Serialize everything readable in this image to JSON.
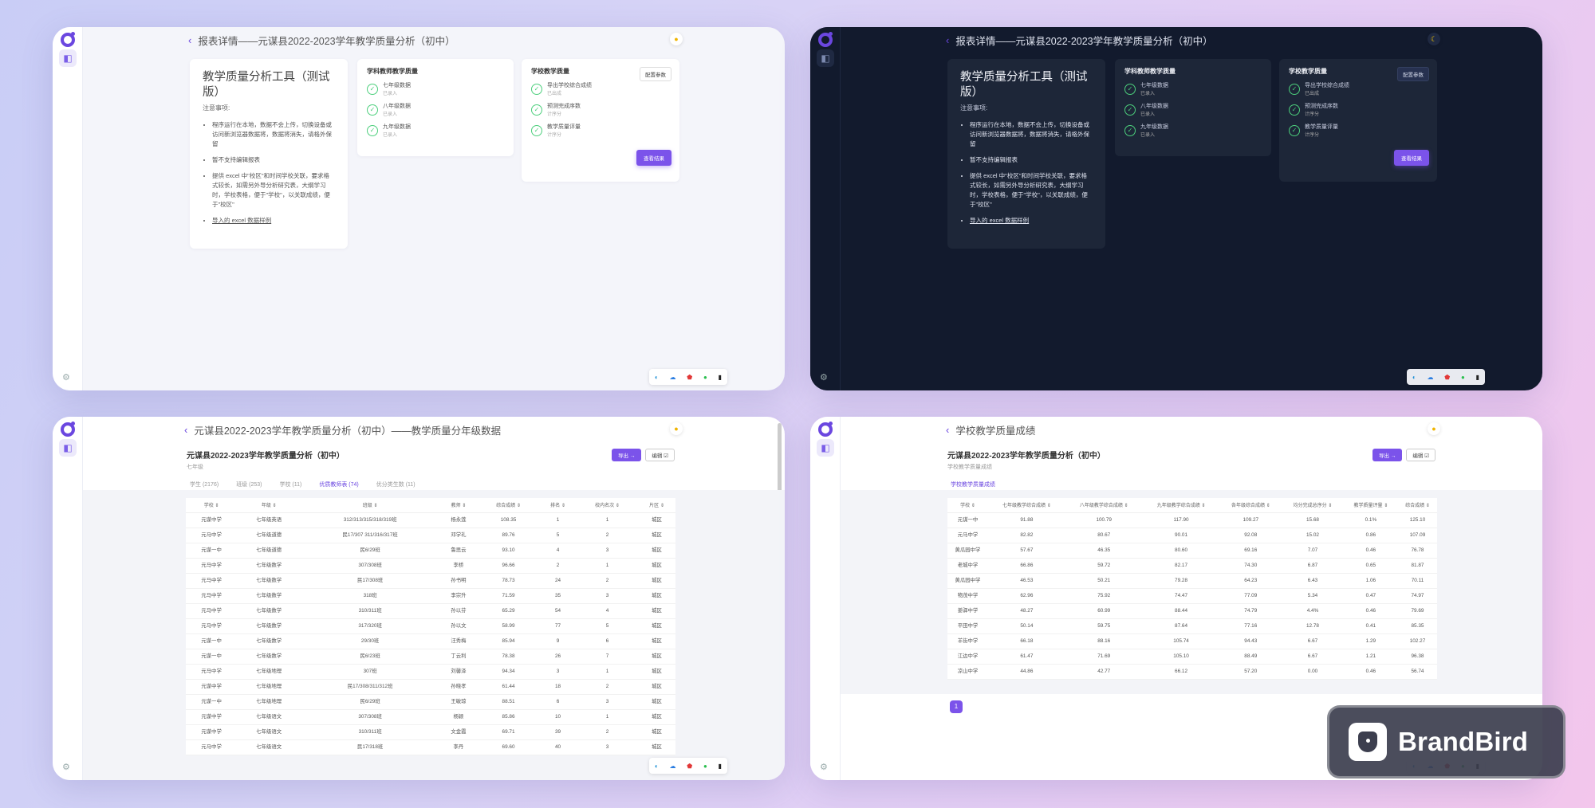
{
  "panel1": {
    "title": "报表详情——元谋县2022-2023学年教学质量分析（初中）",
    "intro": {
      "heading": "教学质量分析工具（测试版）",
      "notice": "注意事项:",
      "items": [
        "程序运行在本地，数据不会上传，切换设备或访问新浏览器数据将，数据将消失，请格外保留",
        "暂不支持编辑报表",
        "提供 excel 中\"校区\"和时间学校关联，要求格式较长，如需另外导分析研究表，大纲学习 时，学校表格，便于\"学校\"，以关联成绩，便于\"校区\"",
        "导入的 excel 数据样例"
      ]
    },
    "mid": {
      "title": "学科教师教学质量",
      "steps": [
        {
          "label": "七年级数据",
          "sub": "已录入"
        },
        {
          "label": "八年级数据",
          "sub": "已录入"
        },
        {
          "label": "九年级数据",
          "sub": "已录入"
        }
      ]
    },
    "right": {
      "title": "学校教学质量",
      "config": "配置参数",
      "steps": [
        {
          "label": "导出学校综合成绩",
          "sub": "已出成"
        },
        {
          "label": "预测完成序数",
          "sub": "计序分"
        },
        {
          "label": "教学质量评量",
          "sub": "计序分"
        }
      ],
      "go": "查看结果"
    }
  },
  "panel2": {
    "title": "报表详情——元谋县2022-2023学年教学质量分析（初中）"
  },
  "panel3": {
    "title": "元谋县2022-2023学年教学质量分析（初中）——教学质量分年级数据",
    "report": "元谋县2022-2023学年教学质量分析（初中）",
    "sub": "七年级",
    "export": "导出 →",
    "edit": "编辑 ☑",
    "tabs": [
      "学生 (2176)",
      "班级 (253)",
      "学校 (11)",
      "优质教师表 (74)",
      "优分类生数 (11)"
    ],
    "headers": [
      "学校 ⇕",
      "年级 ⇕",
      "班级 ⇕",
      "教师 ⇕",
      "综合成绩 ⇕",
      "排名 ⇕",
      "校内名次 ⇕",
      "片区 ⇕"
    ],
    "rows": [
      [
        "元谋中学",
        "七年级英语",
        "312/313/315/318/319班",
        "杨永莲",
        "108.35",
        "1",
        "1",
        "城区"
      ],
      [
        "元马中学",
        "七年级道德",
        "民17/307 311/316/317班",
        "邓学礼",
        "89.76",
        "5",
        "2",
        "城区"
      ],
      [
        "元谋一中",
        "七年级道德",
        "民6/29班",
        "鲁思云",
        "93.10",
        "4",
        "3",
        "城区"
      ],
      [
        "元马中学",
        "七年级数学",
        "307/308班",
        "李桥",
        "96.66",
        "2",
        "1",
        "城区"
      ],
      [
        "元马中学",
        "七年级数学",
        "民17/308班",
        "孙书明",
        "78.73",
        "24",
        "2",
        "城区"
      ],
      [
        "元马中学",
        "七年级数学",
        "318班",
        "李宗升",
        "71.59",
        "35",
        "3",
        "城区"
      ],
      [
        "元马中学",
        "七年级数学",
        "310/311班",
        "孙以芬",
        "65.29",
        "54",
        "4",
        "城区"
      ],
      [
        "元马中学",
        "七年级数学",
        "317/320班",
        "孙以文",
        "58.99",
        "77",
        "5",
        "城区"
      ],
      [
        "元谋一中",
        "七年级数学",
        "29/30班",
        "汪秀梅",
        "85.94",
        "9",
        "6",
        "城区"
      ],
      [
        "元谋一中",
        "七年级数学",
        "民6/23班",
        "丁云利",
        "78.38",
        "26",
        "7",
        "城区"
      ],
      [
        "元马中学",
        "七年级地理",
        "307班",
        "刘馨泽",
        "94.34",
        "3",
        "1",
        "城区"
      ],
      [
        "元谋中学",
        "七年级地理",
        "民17/308/311/312班",
        "孙晓孝",
        "61.44",
        "18",
        "2",
        "城区"
      ],
      [
        "元谋一中",
        "七年级地理",
        "民6/29班",
        "王敏琼",
        "88.51",
        "6",
        "3",
        "城区"
      ],
      [
        "元谋中学",
        "七年级语文",
        "307/308班",
        "杨颖",
        "85.86",
        "10",
        "1",
        "城区"
      ],
      [
        "元谋中学",
        "七年级语文",
        "310/311班",
        "文金霞",
        "69.71",
        "39",
        "2",
        "城区"
      ],
      [
        "元马中学",
        "七年级语文",
        "民17/318班",
        "李丹",
        "69.60",
        "40",
        "3",
        "城区"
      ]
    ]
  },
  "panel4": {
    "title": "学校教学质量成绩",
    "report": "元谋县2022-2023学年教学质量分析（初中）",
    "sub": "学校教学质量成绩",
    "export": "导出 →",
    "edit": "编辑 ☑",
    "tab": "学校教学质量成绩",
    "headers": [
      "学校 ⇕",
      "七年级教学综合成绩 ⇕",
      "八年级教学综合成绩 ⇕",
      "九年级教学综合成绩 ⇕",
      "各年级综合成绩 ⇕",
      "均分完成总序分 ⇕",
      "教学质量评量 ⇕",
      "综合成绩 ⇕"
    ],
    "rows": [
      [
        "元谋一中",
        "91.88",
        "100.79",
        "117.90",
        "109.27",
        "15.68",
        "0.1%",
        "125.10"
      ],
      [
        "元马中学",
        "82.82",
        "80.67",
        "90.01",
        "92.08",
        "15.02",
        "0.86",
        "107.09"
      ],
      [
        "黄瓜园中学",
        "57.67",
        "46.35",
        "80.60",
        "69.16",
        "7.07",
        "0.46",
        "76.78"
      ],
      [
        "老城中学",
        "66.86",
        "59.72",
        "82.17",
        "74.30",
        "6.87",
        "0.65",
        "81.87"
      ],
      [
        "黄瓜园中学",
        "46.53",
        "50.21",
        "79.28",
        "64.23",
        "6.43",
        "1.06",
        "70.11"
      ],
      [
        "物茂中学",
        "62.96",
        "75.92",
        "74.47",
        "77.09",
        "5.34",
        "0.47",
        "74.97"
      ],
      [
        "姜驿中学",
        "48.27",
        "60.99",
        "88.44",
        "74.79",
        "4.4%",
        "0.46",
        "79.69"
      ],
      [
        "平田中学",
        "50.14",
        "59.75",
        "87.64",
        "77.16",
        "12.78",
        "0.41",
        "85.35"
      ],
      [
        "羊街中学",
        "66.18",
        "88.16",
        "105.74",
        "94.43",
        "6.67",
        "1.29",
        "102.27"
      ],
      [
        "江边中学",
        "61.47",
        "71.69",
        "105.10",
        "88.49",
        "6.67",
        "1.21",
        "96.38"
      ],
      [
        "凉山中学",
        "44.86",
        "42.77",
        "66.12",
        "57.20",
        "0.00",
        "0.46",
        "56.74"
      ]
    ],
    "page": "1"
  },
  "brand": "BrandBird",
  "tray_icons": [
    "edge-icon",
    "cloud-icon",
    "shield-icon",
    "wechat-icon",
    "bookmark-icon"
  ]
}
